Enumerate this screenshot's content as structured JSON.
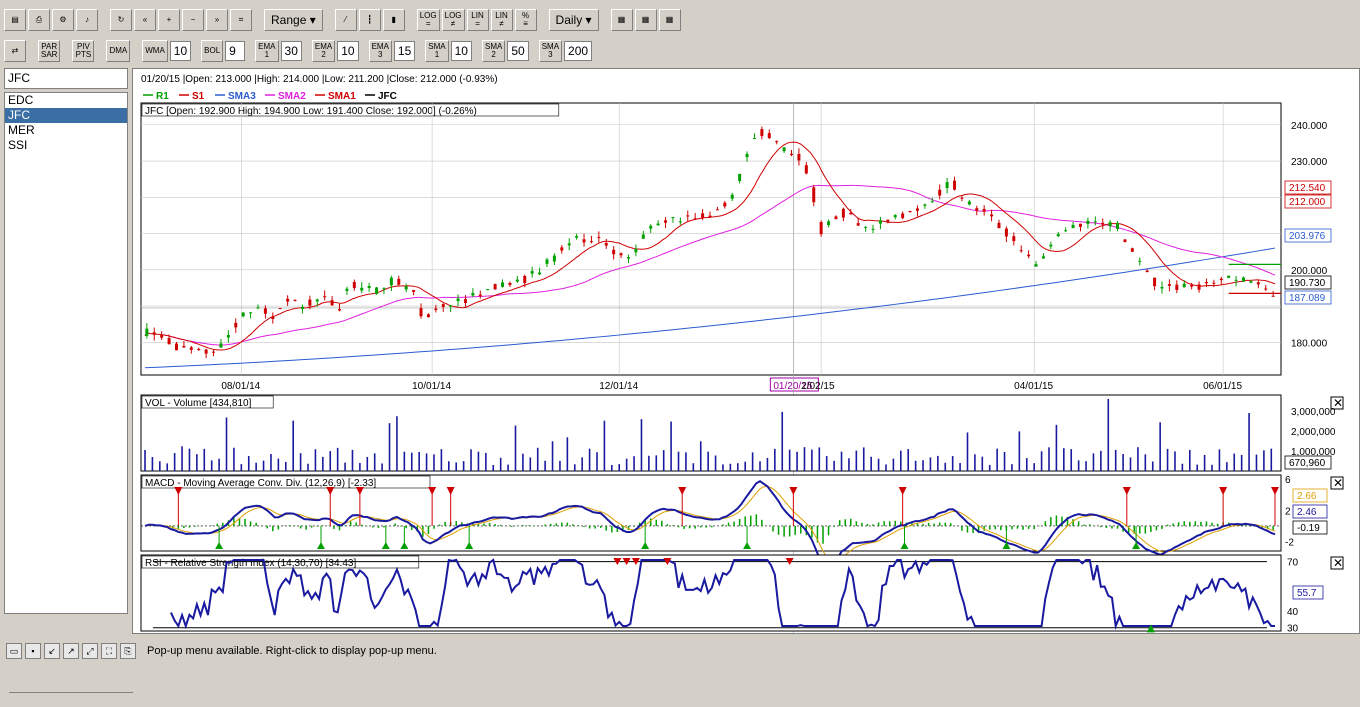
{
  "toolbar1": {
    "buttons": [
      {
        "name": "save-chart",
        "label": "▤"
      },
      {
        "name": "print-chart",
        "label": "⎙"
      },
      {
        "name": "settings",
        "label": "⚙"
      },
      {
        "name": "sound",
        "label": "♪"
      },
      {
        "name": "refresh",
        "label": "↻"
      },
      {
        "name": "scroll-left",
        "label": "«"
      },
      {
        "name": "zoom-in",
        "label": "+"
      },
      {
        "name": "zoom-out",
        "label": "−"
      },
      {
        "name": "scroll-right",
        "label": "»"
      },
      {
        "name": "fit",
        "label": "⌗"
      }
    ],
    "range_label": "Range",
    "chart_types": [
      {
        "name": "line",
        "label": "⁄"
      },
      {
        "name": "bar",
        "label": "┇"
      },
      {
        "name": "candle",
        "label": "▮"
      }
    ],
    "scale_buttons": [
      {
        "name": "log-eq",
        "label": "LOG\n="
      },
      {
        "name": "log-neq",
        "label": "LOG\n≠"
      },
      {
        "name": "lin-eq",
        "label": "LIN\n="
      },
      {
        "name": "lin-neq",
        "label": "LIN\n≠"
      },
      {
        "name": "percent",
        "label": "%\n≡"
      }
    ],
    "period_label": "Daily"
  },
  "toolbar2": {
    "items": [
      {
        "name": "draw-tool",
        "label": "⇄",
        "value": ""
      },
      {
        "name": "par-sar",
        "label": "PAR\nSAR",
        "value": ""
      },
      {
        "name": "piv-pts",
        "label": "PIV\nPTS",
        "value": ""
      },
      {
        "name": "dma",
        "label": "DMA",
        "value": ""
      },
      {
        "name": "wma",
        "label": "WMA",
        "value": "10"
      },
      {
        "name": "bol",
        "label": "BOL",
        "value": "9"
      },
      {
        "name": "ema1",
        "label": "EMA\n1",
        "value": "30"
      },
      {
        "name": "ema2",
        "label": "EMA\n2",
        "value": "10"
      },
      {
        "name": "ema3",
        "label": "EMA\n3",
        "value": "15"
      },
      {
        "name": "sma1",
        "label": "SMA\n1",
        "value": "10"
      },
      {
        "name": "sma2",
        "label": "SMA\n2",
        "value": "50"
      },
      {
        "name": "sma3",
        "label": "SMA\n3",
        "value": "200"
      }
    ]
  },
  "symbol_input": "JFC",
  "symbols": [
    "EDC",
    "JFC",
    "MER",
    "SSI"
  ],
  "selected_symbol": "JFC",
  "statusbar": {
    "text": "Pop-up menu available. Right-click to display pop-up menu."
  },
  "chart_data": {
    "type": "candlestick",
    "info_line": "01/20/15 |Open: 213.000 |High: 214.000 |Low: 211.200 |Close: 212.000 (-0.93%)",
    "legend": [
      {
        "name": "R1",
        "color": "#00a000"
      },
      {
        "name": "S1",
        "color": "#d00000"
      },
      {
        "name": "SMA3",
        "color": "#2a5cd0"
      },
      {
        "name": "SMA2",
        "color": "#e020e0"
      },
      {
        "name": "SMA1",
        "color": "#d00000"
      },
      {
        "name": "JFC",
        "color": "#000000"
      }
    ],
    "price_title": "JFC [Open: 192.900  High: 194.900  Low: 191.400  Close: 192.000] (-0.26%)",
    "x_labels": [
      "08/01/14",
      "10/01/14",
      "12/01/14",
      "01/20/15",
      "2/02/15",
      "04/01/15",
      "06/01/15"
    ],
    "y_ticks": [
      180,
      190,
      200,
      210,
      220,
      230,
      240
    ],
    "y_tick_labels": [
      "180.000",
      "",
      "200.000",
      "",
      "220.000",
      "230.000",
      "240.000"
    ],
    "ylim": [
      171,
      246
    ],
    "markers": [
      {
        "label": "212.540",
        "value": 212.54,
        "color": "#d00000"
      },
      {
        "label": "212.000",
        "value": 212.0,
        "color": "#d00000"
      },
      {
        "label": "203.976",
        "value": 203.976,
        "color": "#2a5cd0"
      },
      {
        "label": "190.730",
        "value": 190.73,
        "color": "#000000"
      },
      {
        "label": "187.089",
        "value": 187.089,
        "color": "#2a5cd0"
      }
    ],
    "r1": [
      {
        "value": 201.5
      }
    ],
    "s1": [
      {
        "value": 193.5
      }
    ],
    "close_keypoints": [
      [
        0,
        183
      ],
      [
        10,
        181
      ],
      [
        20,
        178
      ],
      [
        30,
        177
      ],
      [
        40,
        178
      ],
      [
        50,
        186
      ],
      [
        60,
        190
      ],
      [
        70,
        186
      ],
      [
        75,
        192
      ],
      [
        85,
        190
      ],
      [
        95,
        192
      ],
      [
        105,
        190
      ],
      [
        110,
        196
      ],
      [
        125,
        194
      ],
      [
        135,
        198
      ],
      [
        145,
        193
      ],
      [
        150,
        186
      ],
      [
        160,
        190
      ],
      [
        175,
        192
      ],
      [
        190,
        196
      ],
      [
        200,
        196
      ],
      [
        210,
        199
      ],
      [
        220,
        203
      ],
      [
        230,
        208
      ],
      [
        245,
        209
      ],
      [
        260,
        202
      ],
      [
        270,
        210
      ],
      [
        280,
        214
      ],
      [
        295,
        214
      ],
      [
        310,
        216
      ],
      [
        320,
        224
      ],
      [
        330,
        239
      ],
      [
        340,
        235
      ],
      [
        350,
        232
      ],
      [
        355,
        230
      ],
      [
        360,
        222
      ],
      [
        365,
        210
      ],
      [
        375,
        216
      ],
      [
        390,
        212
      ],
      [
        405,
        214
      ],
      [
        420,
        218
      ],
      [
        430,
        222
      ],
      [
        435,
        224
      ],
      [
        445,
        218
      ],
      [
        455,
        215
      ],
      [
        465,
        210
      ],
      [
        475,
        205
      ],
      [
        480,
        200
      ],
      [
        490,
        208
      ],
      [
        500,
        212
      ],
      [
        515,
        214
      ],
      [
        525,
        212
      ],
      [
        535,
        203
      ],
      [
        545,
        196
      ],
      [
        560,
        195
      ],
      [
        575,
        196
      ],
      [
        590,
        198
      ],
      [
        600,
        197
      ],
      [
        610,
        192
      ]
    ],
    "sma3_start": 173,
    "sma3_end": 206,
    "volume": {
      "title": "VOL - Volume [434,810]",
      "ylim": [
        0,
        3800000
      ],
      "y_ticks": [
        1000000,
        2000000,
        3000000
      ],
      "y_tick_labels": [
        "1,000,000",
        "2,000,000",
        "3,000,000"
      ],
      "last_label": "670,960"
    },
    "macd": {
      "title": "MACD - Moving Average Conv. Div. (12,26,9) [-2.33]",
      "ylim": [
        -3.2,
        6.5
      ],
      "y_ticks": [
        -2,
        2,
        6
      ],
      "y_tick_labels": [
        "-2",
        "2",
        "6"
      ],
      "markers": [
        "2.66",
        "2.46",
        "-0.19"
      ]
    },
    "rsi": {
      "title": "RSI - Relative Strength Index (14,30,70) [34.43]",
      "ylim": [
        28,
        74
      ],
      "y_ticks": [
        30,
        40,
        50,
        60,
        70
      ],
      "y_tick_labels": [
        "30",
        "40",
        "",
        "",
        "70"
      ],
      "markers": [
        "55.7"
      ],
      "bands": [
        30,
        70
      ]
    }
  }
}
